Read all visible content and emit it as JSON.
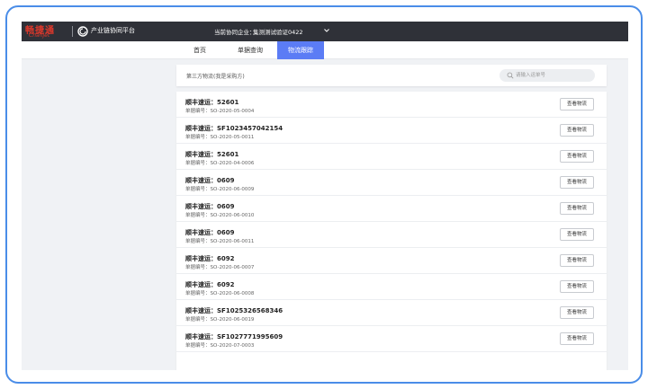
{
  "header": {
    "logo_cn": "畅捷通",
    "logo_en": "Chanjet",
    "platform_name": "产业链协同平台",
    "company_label": "当前协同企业：",
    "company_value": "集测测试验证0422"
  },
  "nav": {
    "tabs": [
      {
        "label": "首页",
        "active": false
      },
      {
        "label": "单据查询",
        "active": false
      },
      {
        "label": "物流跟踪",
        "active": true
      }
    ]
  },
  "filter": {
    "title": "第三方物流(我是采购方)",
    "search_placeholder": "请输入运单号"
  },
  "shipments": {
    "button_label": "查看物流",
    "items": [
      {
        "title": "顺丰速运：52601",
        "doc": "单据编号：SO-2020-05-0004"
      },
      {
        "title": "顺丰速运：SF1023457042154",
        "doc": "单据编号：SO-2020-05-0011"
      },
      {
        "title": "顺丰速运：52601",
        "doc": "单据编号：SO-2020-04-0006"
      },
      {
        "title": "顺丰速运：0609",
        "doc": "单据编号：SO-2020-06-0009"
      },
      {
        "title": "顺丰速运：0609",
        "doc": "单据编号：SO-2020-06-0010"
      },
      {
        "title": "顺丰速运：0609",
        "doc": "单据编号：SO-2020-06-0011"
      },
      {
        "title": "顺丰速运：6092",
        "doc": "单据编号：SO-2020-06-0007"
      },
      {
        "title": "顺丰速运：6092",
        "doc": "单据编号：SO-2020-06-0008"
      },
      {
        "title": "顺丰速运：SF1025326568346",
        "doc": "单据编号：SO-2020-06-0019"
      },
      {
        "title": "顺丰速运：SF1027771995609",
        "doc": "单据编号：SO-2020-07-0003"
      }
    ]
  },
  "colors": {
    "accent": "#5b7cf5",
    "brand": "#e0382b",
    "topbar": "#2f3138",
    "frame_border": "#4a8de8"
  },
  "icons": {
    "platform": "platform-logo-icon",
    "company_select": "chevron-down-icon",
    "search": "search-icon"
  }
}
